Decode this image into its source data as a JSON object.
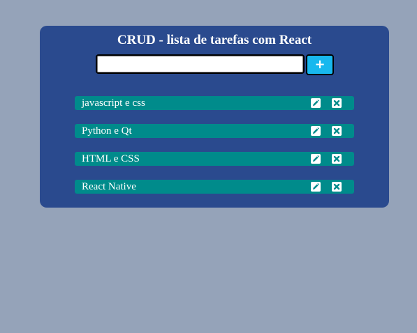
{
  "header": {
    "title": "CRUD - lista de tarefas com React"
  },
  "form": {
    "input_value": "",
    "add_label": "+"
  },
  "tasks": [
    {
      "label": "javascript e css",
      "edit_icon": "pencil-icon",
      "delete_icon": "close-icon"
    },
    {
      "label": "Python e Qt",
      "edit_icon": "pencil-icon",
      "delete_icon": "close-icon"
    },
    {
      "label": "HTML e CSS",
      "edit_icon": "pencil-icon",
      "delete_icon": "close-icon"
    },
    {
      "label": "React Native",
      "edit_icon": "pencil-icon",
      "delete_icon": "close-icon"
    }
  ],
  "colors": {
    "background": "#95a3b9",
    "card": "#2a4a8e",
    "task_row": "#008b8b",
    "add_button": "#18b8ee"
  }
}
